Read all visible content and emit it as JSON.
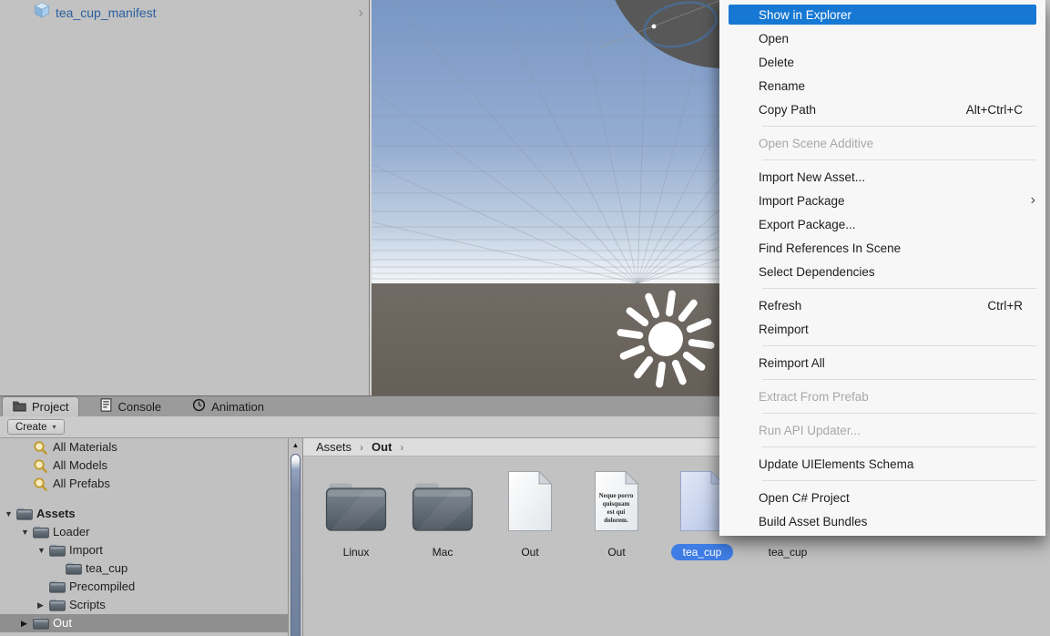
{
  "colors": {
    "menu_highlight": "#1678d3",
    "selection_blue": "#3f7de5",
    "asset_link_blue": "#2a5f9e",
    "tree_selected_gray": "#8f8f8f",
    "sky_top": "#7897c5",
    "ground": "#6e6862"
  },
  "inspector": {
    "selected_item": {
      "label": "tea_cup_manifest",
      "icon": "cube-icon",
      "chevron": "›"
    }
  },
  "context_menu": {
    "items": [
      {
        "label": "Show in Explorer",
        "state": "highlighted"
      },
      {
        "label": "Open"
      },
      {
        "label": "Delete"
      },
      {
        "label": "Rename"
      },
      {
        "label": "Copy Path",
        "shortcut": "Alt+Ctrl+C"
      },
      {
        "type": "separator"
      },
      {
        "label": "Open Scene Additive",
        "state": "disabled"
      },
      {
        "type": "separator"
      },
      {
        "label": "Import New Asset..."
      },
      {
        "label": "Import Package",
        "submenu": true
      },
      {
        "label": "Export Package..."
      },
      {
        "label": "Find References In Scene"
      },
      {
        "label": "Select Dependencies"
      },
      {
        "type": "separator"
      },
      {
        "label": "Refresh",
        "shortcut": "Ctrl+R"
      },
      {
        "label": "Reimport"
      },
      {
        "type": "separator"
      },
      {
        "label": "Reimport All"
      },
      {
        "type": "separator"
      },
      {
        "label": "Extract From Prefab",
        "state": "disabled"
      },
      {
        "type": "separator"
      },
      {
        "label": "Run API Updater...",
        "state": "disabled"
      },
      {
        "type": "separator"
      },
      {
        "label": "Update UIElements Schema"
      },
      {
        "type": "separator"
      },
      {
        "label": "Open C# Project"
      },
      {
        "label": "Build Asset Bundles"
      }
    ],
    "submenu_glyph": "›"
  },
  "bottom_panel": {
    "tabs": [
      {
        "label": "Project",
        "icon": "project-tab-icon",
        "active": true
      },
      {
        "label": "Console",
        "icon": "console-tab-icon",
        "active": false
      },
      {
        "label": "Animation",
        "icon": "clock-icon",
        "active": false
      }
    ],
    "toolbar": {
      "create_label": "Create",
      "dropdown_glyph": "▾"
    },
    "tree": {
      "filters": [
        {
          "label": "All Materials",
          "icon": "search-icon"
        },
        {
          "label": "All Models",
          "icon": "search-icon"
        },
        {
          "label": "All Prefabs",
          "icon": "search-icon"
        }
      ],
      "folders": [
        {
          "label": "Assets",
          "depth": 0,
          "arrow": "expanded",
          "bold": true
        },
        {
          "label": "Loader",
          "depth": 1,
          "arrow": "expanded"
        },
        {
          "label": "Import",
          "depth": 2,
          "arrow": "expanded"
        },
        {
          "label": "tea_cup",
          "depth": 3,
          "arrow": "none"
        },
        {
          "label": "Precompiled",
          "depth": 2,
          "arrow": "none"
        },
        {
          "label": "Scripts",
          "depth": 2,
          "arrow": "collapsed"
        },
        {
          "label": "Out",
          "depth": 1,
          "arrow": "collapsed",
          "selected": true
        }
      ]
    },
    "breadcrumb": {
      "segments": [
        {
          "label": "Assets",
          "bold": false
        },
        {
          "label": "Out",
          "bold": true
        }
      ],
      "separator": "›"
    },
    "assets": [
      {
        "label": "Linux",
        "icon": "folder"
      },
      {
        "label": "Mac",
        "icon": "folder"
      },
      {
        "label": "Out",
        "icon": "file-blank"
      },
      {
        "label": "Out",
        "icon": "file-text",
        "preview_text": "Neque porro quisquam est qui dolorem."
      },
      {
        "label": "tea_cup",
        "icon": "file-blue",
        "selected": true
      },
      {
        "label": "tea_cup",
        "icon": "file-blank"
      }
    ]
  }
}
